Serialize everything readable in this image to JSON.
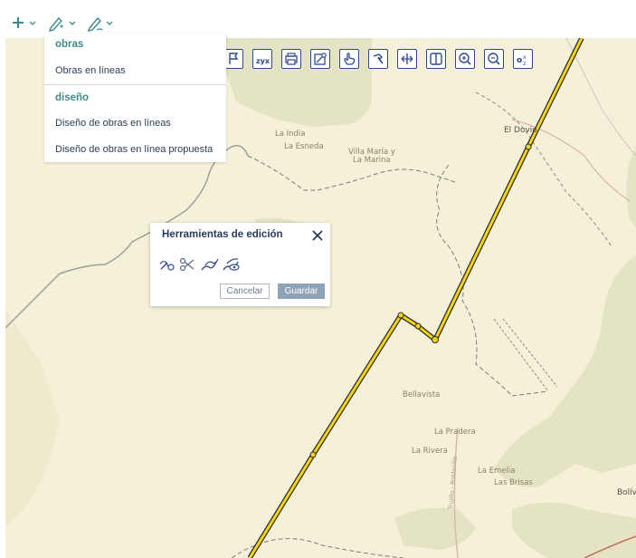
{
  "toolbar": {
    "add_icon": "plus-icon",
    "edit_icon": "pencil-magic-icon",
    "draw_icon": "pencil-line-icon"
  },
  "map_tools": [
    "flag-icon",
    "coordinates-icon",
    "printer-icon",
    "clear-map-icon",
    "pan-hand-icon",
    "hammer-icon",
    "move-horizontal-icon",
    "split-view-icon",
    "zoom-in-icon",
    "zoom-out-icon",
    "scale-icon"
  ],
  "dropdown": {
    "section1": "obras",
    "item1": "Obras en líneas",
    "section2": "diseño",
    "item2": "Diseño de obras en líneas",
    "item3": "Diseño de obras en línea propuesta"
  },
  "dialog": {
    "title": "Herramientas de edición",
    "cancel": "Cancelar",
    "save": "Guardar",
    "tools": [
      "bike-node-icon",
      "scissors-icon",
      "line-edit-icon",
      "line-view-icon"
    ]
  },
  "places": {
    "la_india": "La India",
    "la_esneda": "La Esneda",
    "villa_maria": "Villa María y",
    "la_marina": "La Marina",
    "el_dovio": "El Dovio",
    "bellavista": "Bellavista",
    "la_pradera": "La Pradera",
    "la_rivera": "La Rivera",
    "la_emelia": "La Emelia",
    "las_brisas": "Las Brisas",
    "bolivar": "Bolív",
    "road": "Trujillo - Roldanillo"
  },
  "colors": {
    "line": "#f6d40e",
    "accent": "#3d8a8a",
    "map_bg": "#f5f1d9",
    "terrain": "#e4e4c4"
  }
}
